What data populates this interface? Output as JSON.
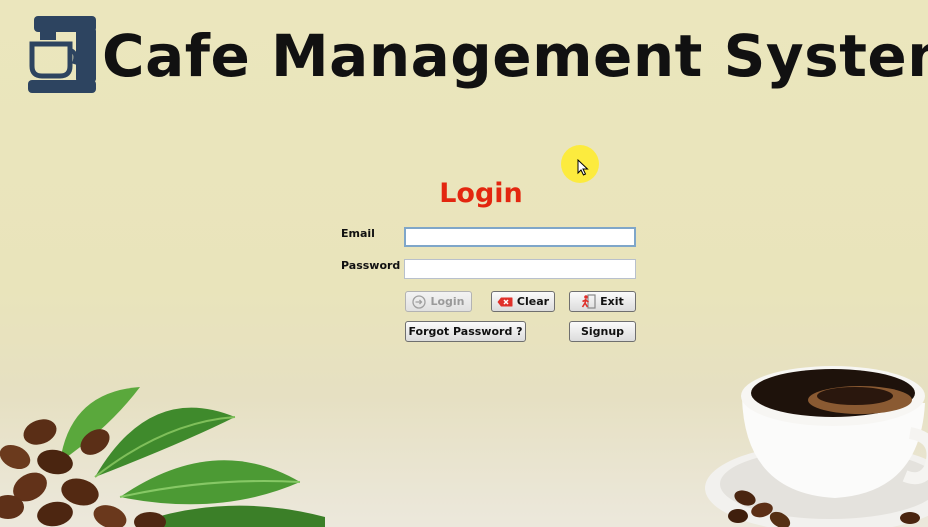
{
  "header": {
    "title": "Cafe Management System",
    "logo_icon": "coffee-maker-icon"
  },
  "login": {
    "heading": "Login",
    "email_label": "Email",
    "password_label": "Password",
    "email_value": "",
    "password_value": ""
  },
  "buttons": {
    "login": {
      "label": "Login",
      "icon": "login-arrow-icon",
      "enabled": false
    },
    "clear": {
      "label": "Clear",
      "icon": "clear-icon"
    },
    "exit": {
      "label": "Exit",
      "icon": "exit-door-icon"
    },
    "forgot": {
      "label": "Forgot Password ?"
    },
    "signup": {
      "label": "Signup"
    }
  },
  "colors": {
    "background": "#ebe6bd",
    "heading": "#e3260f",
    "logo": "#2d4460",
    "cursor_highlight": "#ffec28"
  }
}
